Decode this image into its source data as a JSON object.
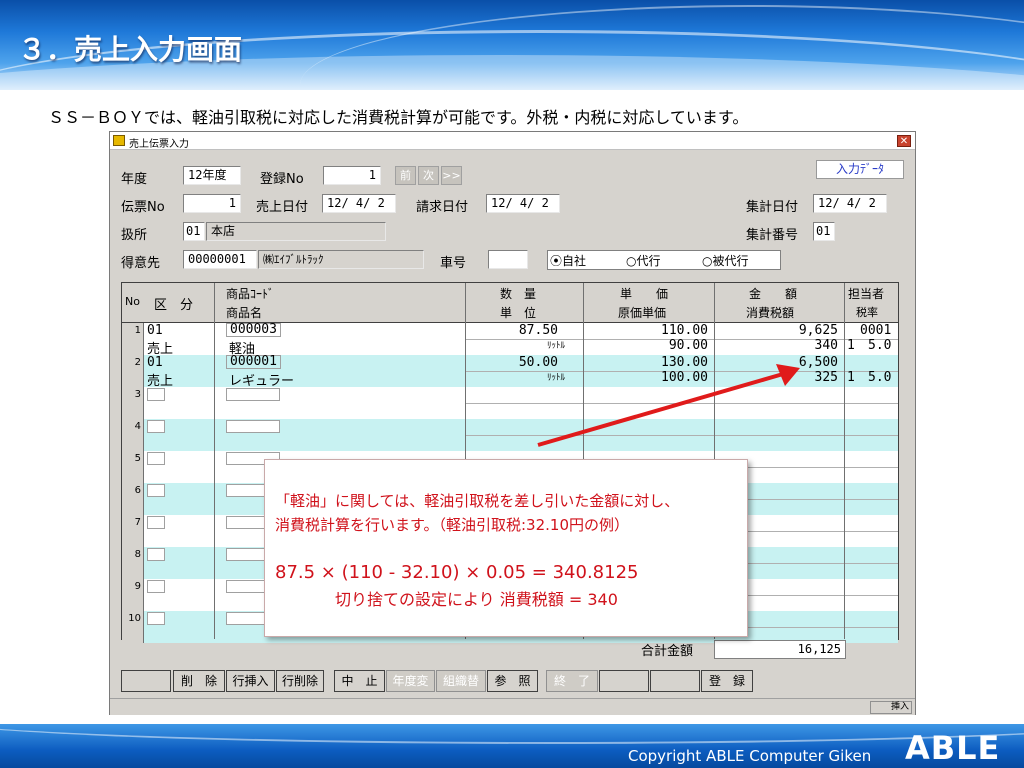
{
  "slide": {
    "title": "３．売上入力画面",
    "subtitle": "ＳＳ－ＢＯＹでは、軽油引取税に対応した消費税計算が可能です。外税・内税に対応しています。",
    "copyright": "Copyright ABLE Computer Giken",
    "logo": "ABLE"
  },
  "window": {
    "title": "売上伝票入力",
    "close_glyph": "✕",
    "input_data_btn": "入力ﾃﾞｰﾀ"
  },
  "form": {
    "year_label": "年度",
    "year_value": "12年度",
    "regno_label": "登録No",
    "regno_value": "1",
    "nav_prev": "前",
    "nav_next": "次",
    "nav_last": ">>",
    "slipno_label": "伝票No",
    "slipno_value": "1",
    "sales_date_label": "売上日付",
    "sales_date_value": "12/ 4/ 2",
    "bill_date_label": "請求日付",
    "bill_date_value": "12/ 4/ 2",
    "sum_date_label": "集計日付",
    "sum_date_value": "12/ 4/ 2",
    "office_label": "扱所",
    "office_code": "01",
    "office_name": "本店",
    "sum_no_label": "集計番号",
    "sum_no_value": "01",
    "customer_label": "得意先",
    "customer_code": "00000001",
    "customer_name": "㈱ｴｲﾌﾞﾙﾄﾗｯｸ",
    "car_label": "車号",
    "car_value": "",
    "radio_self": "自社",
    "radio_agent": "代行",
    "radio_beagent": "被代行"
  },
  "grid": {
    "headers": {
      "no": "No",
      "kubun": "区　分",
      "code1": "商品ｺｰﾄﾞ",
      "code2": "商品名",
      "qty1": "数　量",
      "qty2": "単　位",
      "price1": "単　　価",
      "price2": "原価単価",
      "amount1": "金　　額",
      "amount2": "消費税額",
      "staff1": "担当者",
      "staff2": "税率"
    },
    "rows": [
      {
        "no": "1",
        "kubun_code": "01",
        "kubun_name": "売上",
        "item_code": "000003",
        "item_name": "軽油",
        "qty": "87.50",
        "unit": "ﾘｯﾄﾙ",
        "price": "110.00",
        "cost": "90.00",
        "amount": "9,625",
        "tax": "340",
        "staff": "0001",
        "tax_flag": "1",
        "tax_rate": "5.0"
      },
      {
        "no": "2",
        "kubun_code": "01",
        "kubun_name": "売上",
        "item_code": "000001",
        "item_name": "レギュラー",
        "qty": "50.00",
        "unit": "ﾘｯﾄﾙ",
        "price": "130.00",
        "cost": "100.00",
        "amount": "6,500",
        "tax": "325",
        "staff": "",
        "tax_flag": "1",
        "tax_rate": "5.0"
      },
      {
        "no": "3"
      },
      {
        "no": "4"
      },
      {
        "no": "5"
      },
      {
        "no": "6"
      },
      {
        "no": "7"
      },
      {
        "no": "8"
      },
      {
        "no": "9"
      },
      {
        "no": "10"
      }
    ]
  },
  "totals": {
    "label": "合計金額",
    "value": "16,125"
  },
  "buttons": [
    "",
    "削　除",
    "行挿入",
    "行削除",
    "中　止",
    "年度変",
    "組織替",
    "参　照",
    "終　了",
    "",
    "",
    "登　録"
  ],
  "status": {
    "mode": "挿入"
  },
  "callout": {
    "line1": "「軽油」に関しては、軽油引取税を差し引いた金額に対し、",
    "line2": "消費税計算を行います。（軽油引取税:32.10円の例）",
    "formula": "87.5 × (110 - 32.10) × 0.05 = 340.8125",
    "result": "切り捨ての設定により 消費税額 = 340"
  },
  "colors": {
    "callout_text": "#d0121b",
    "arrow": "#e01b1b",
    "row_alt": "#c8f2f2"
  }
}
